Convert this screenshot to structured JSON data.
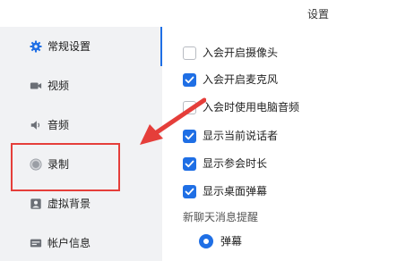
{
  "window": {
    "title": "设置"
  },
  "sidebar": {
    "items": [
      {
        "label": "常规设置",
        "icon": "gear-icon",
        "active": true
      },
      {
        "label": "视频",
        "icon": "video-camera-icon"
      },
      {
        "label": "音频",
        "icon": "speaker-icon"
      },
      {
        "label": "录制",
        "icon": "record-icon"
      },
      {
        "label": "虚拟背景",
        "icon": "virtual-background-icon"
      },
      {
        "label": "帐户信息",
        "icon": "id-card-icon"
      }
    ]
  },
  "settings": {
    "options": [
      {
        "label": "入会开启摄像头",
        "checked": false
      },
      {
        "label": "入会开启麦克风",
        "checked": true
      },
      {
        "label": "入会时使用电脑音频",
        "checked": false
      },
      {
        "label": "显示当前说话者",
        "checked": true
      },
      {
        "label": "显示参会时长",
        "checked": true
      },
      {
        "label": "显示桌面弹幕",
        "checked": true
      }
    ],
    "chat_section_label": "新聊天消息提醒",
    "chat_option": {
      "label": "弹幕",
      "selected": true
    }
  },
  "colors": {
    "accent": "#1f6fe5",
    "annotation": "#e53e3a",
    "sidebar_bg": "#f1f2f4"
  }
}
